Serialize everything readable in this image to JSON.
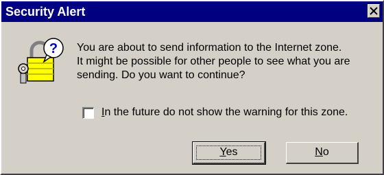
{
  "window": {
    "title": "Security Alert",
    "close_icon": "close-icon",
    "colors": {
      "titlebar": "#000080",
      "face": "#d4d0c8"
    }
  },
  "message": {
    "icon": "lock-key-question-icon",
    "lines": [
      "You are about to send information to the Internet zone.",
      "It might be possible for other people to see what you are",
      "sending. Do you want to continue?"
    ]
  },
  "checkbox": {
    "checked": false,
    "label_accel": "I",
    "label_rest": "n the future do not show the warning for this zone."
  },
  "buttons": {
    "yes_accel": "Y",
    "yes_rest": "es",
    "no_accel": "N",
    "no_rest": "o"
  }
}
